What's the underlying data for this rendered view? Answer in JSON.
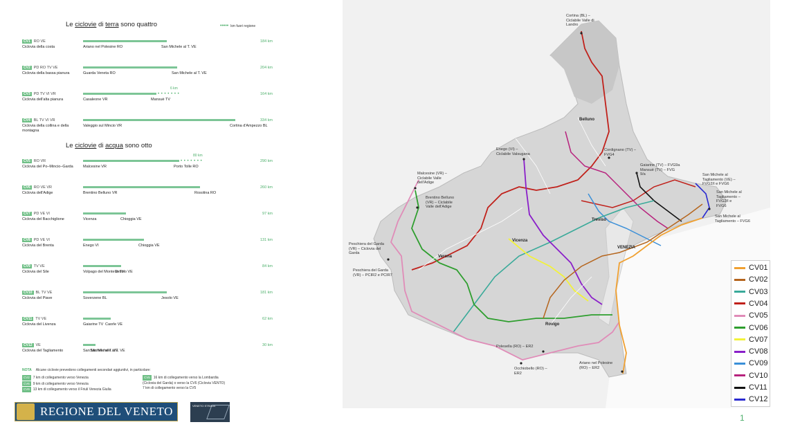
{
  "header": {
    "land_title_pre": "Le ",
    "land_title_u1": "ciclovie",
    "land_title_mid": " di ",
    "land_title_u2": "terra",
    "land_title_post": " sono quattro",
    "water_title_pre": "Le ",
    "water_title_u1": "ciclovie",
    "water_title_mid": " di ",
    "water_title_u2": "acqua",
    "water_title_post": " sono otto",
    "legend_outside": "km fuori regione"
  },
  "land_routes": [
    {
      "code": "CV1",
      "provinces": "RO VE",
      "name": "Ciclovia della costa",
      "from": "Ariano nel Polesine RO",
      "to": "San Michele al T. VE",
      "km": "184 km",
      "bar": 0.33
    },
    {
      "code": "CV2",
      "provinces": "PD RO TV VE",
      "name": "Ciclovia della bassa pianura",
      "from": "Guarda Veneta RO",
      "to": "San Michele al T. VE",
      "km": "204 km",
      "bar": 0.37
    },
    {
      "code": "CV3",
      "provinces": "PD TV VI VR",
      "name": "Ciclovia dell'alta pianura",
      "from": "Casaleone VR",
      "to": "Mansuè TV",
      "km": "164 km",
      "bar": 0.29,
      "extra": "6 km"
    },
    {
      "code": "CV4",
      "provinces": "BL TV VI VR",
      "name": "Ciclovia della collina e della montagna",
      "from": "Valeggio sul Mincio VR",
      "to": "Cortina d'Ampezzo BL",
      "km": "334 km",
      "bar": 0.6
    }
  ],
  "water_routes": [
    {
      "code": "CV5",
      "provinces": "RO VR",
      "name": "Ciclovia del Po–Mincio–Garda",
      "from": "Malcesine VR",
      "to": "Porto Tolle RO",
      "km": "290 km",
      "bar": 0.38,
      "extra": "80 km"
    },
    {
      "code": "CV6",
      "provinces": "RO VE VR",
      "name": "Ciclovia dell'Adige",
      "from": "Brentino Belluno VR",
      "to": "Rosolina RO",
      "km": "260 km",
      "bar": 0.46
    },
    {
      "code": "CV7",
      "provinces": "PD VE VI",
      "name": "Ciclovia del Bacchiglione",
      "from": "Vicenza",
      "to": "Chioggia VE",
      "km": "97 km",
      "bar": 0.17
    },
    {
      "code": "CV8",
      "provinces": "PD VE VI",
      "name": "Ciclovia del Brenta",
      "from": "Enego VI",
      "to": "Chioggia VE",
      "km": "131 km",
      "bar": 0.24
    },
    {
      "code": "CV9",
      "provinces": "TV VE",
      "name": "Ciclovia del Sile",
      "from": "Volpago del Montello TV",
      "to": "Jesolo VE",
      "km": "84 km",
      "bar": 0.15
    },
    {
      "code": "CV10",
      "provinces": "BL TV VE",
      "name": "Ciclovia del Piave",
      "from": "Soverzene BL",
      "to": "Jesolo VE",
      "km": "181 km",
      "bar": 0.33
    },
    {
      "code": "CV11",
      "provinces": "TV VE",
      "name": "Ciclovia del Livenza",
      "from": "Gaiarine TV",
      "to": "Caorle VE",
      "km": "62 km",
      "bar": 0.11
    },
    {
      "code": "CV12",
      "provinces": "VE",
      "name": "Ciclovia del Tagliamento",
      "from": "San Michele al T. VE",
      "to": "San Michele al T. VE",
      "km": "30 km",
      "bar": 0.05
    }
  ],
  "note": {
    "label": "NOTA",
    "intro": "Alcune ciclovie prevedono collegamenti secondari aggiuntivi, in particolare:",
    "left": [
      {
        "chip": "CV2",
        "text": "7 km di collegamento verso Venezia"
      },
      {
        "chip": "CV6",
        "text": "9 km di collegamento verso Venezia"
      },
      {
        "chip": "CV9",
        "text": "13 km di collegamento verso il Friuli Venezia Giulia"
      }
    ],
    "right": [
      {
        "chip": "CV5",
        "text": "16 km di collegamento verso la Lombardia"
      },
      {
        "chip": "",
        "text": "(Ciclovia del Garda) o verso la CV6 (Ciclovia VENTO)"
      },
      {
        "chip": "",
        "text": "7 km di collegamento verso la CV5"
      }
    ]
  },
  "logo": {
    "text": "REGIONE DEL VENETO",
    "secondary": "VENETO STRADE"
  },
  "map_legend": [
    {
      "label": "CV01",
      "color": "#f0a030"
    },
    {
      "label": "CV02",
      "color": "#b5651d"
    },
    {
      "label": "CV03",
      "color": "#3aaa9a"
    },
    {
      "label": "CV04",
      "color": "#c0201a"
    },
    {
      "label": "CV05",
      "color": "#e08cb8"
    },
    {
      "label": "CV06",
      "color": "#2e9e2e"
    },
    {
      "label": "CV07",
      "color": "#f2f23a"
    },
    {
      "label": "CV08",
      "color": "#8a1fc9"
    },
    {
      "label": "CV09",
      "color": "#3a8fd8"
    },
    {
      "label": "CV10",
      "color": "#b7227d"
    },
    {
      "label": "CV11",
      "color": "#111111"
    },
    {
      "label": "CV12",
      "color": "#2a2ad0"
    }
  ],
  "map_labels": {
    "cortina": "Cortina (BL) –\nCiclabile Valle di\nLandro",
    "belluno": "Belluno",
    "enego": "Enego (VI) –\nCiclabile Valsugana",
    "cordignano": "Cordignano (TV) –\nFVG4",
    "gaiarine": "Gaiarine (TV) – FVG9a\nMansuè (TV) – FVG\n9/a",
    "sanmichele1": "San Michele al\nTagliamento (VE) –\nFVG2/I e FVG6",
    "sanmichele2": "San Michele al\nTagliamento –\nFVG2/I e\nFVG6",
    "sanmichele3": "San Michele al\nTagliamento – FVG6",
    "malcesine": "Malcesine (VR) –\nCiclabile Valle\ndell'Adige",
    "brentino": "Brentino Belluno\n(VR) – Ciclabile\nValle dell'Adige",
    "peschiera1": "Peschiera del Garda\n(VR) – Ciclovia del\nGarda",
    "peschiera2": "Peschiera del Garda\n(VR) – PCIR2 e PCIR7",
    "treviso": "Treviso",
    "vicenza": "Vicenza",
    "venezia": "VENEZIA",
    "verona": "Verona",
    "rovigo": "Rovigo",
    "polesella": "Polesella (RO) – ER2",
    "occhiobello": "Occhiobello (RO) –\nER2",
    "ariano": "Ariano nel Polesine\n(RO) – ER2"
  },
  "page": {
    "number": "1"
  }
}
